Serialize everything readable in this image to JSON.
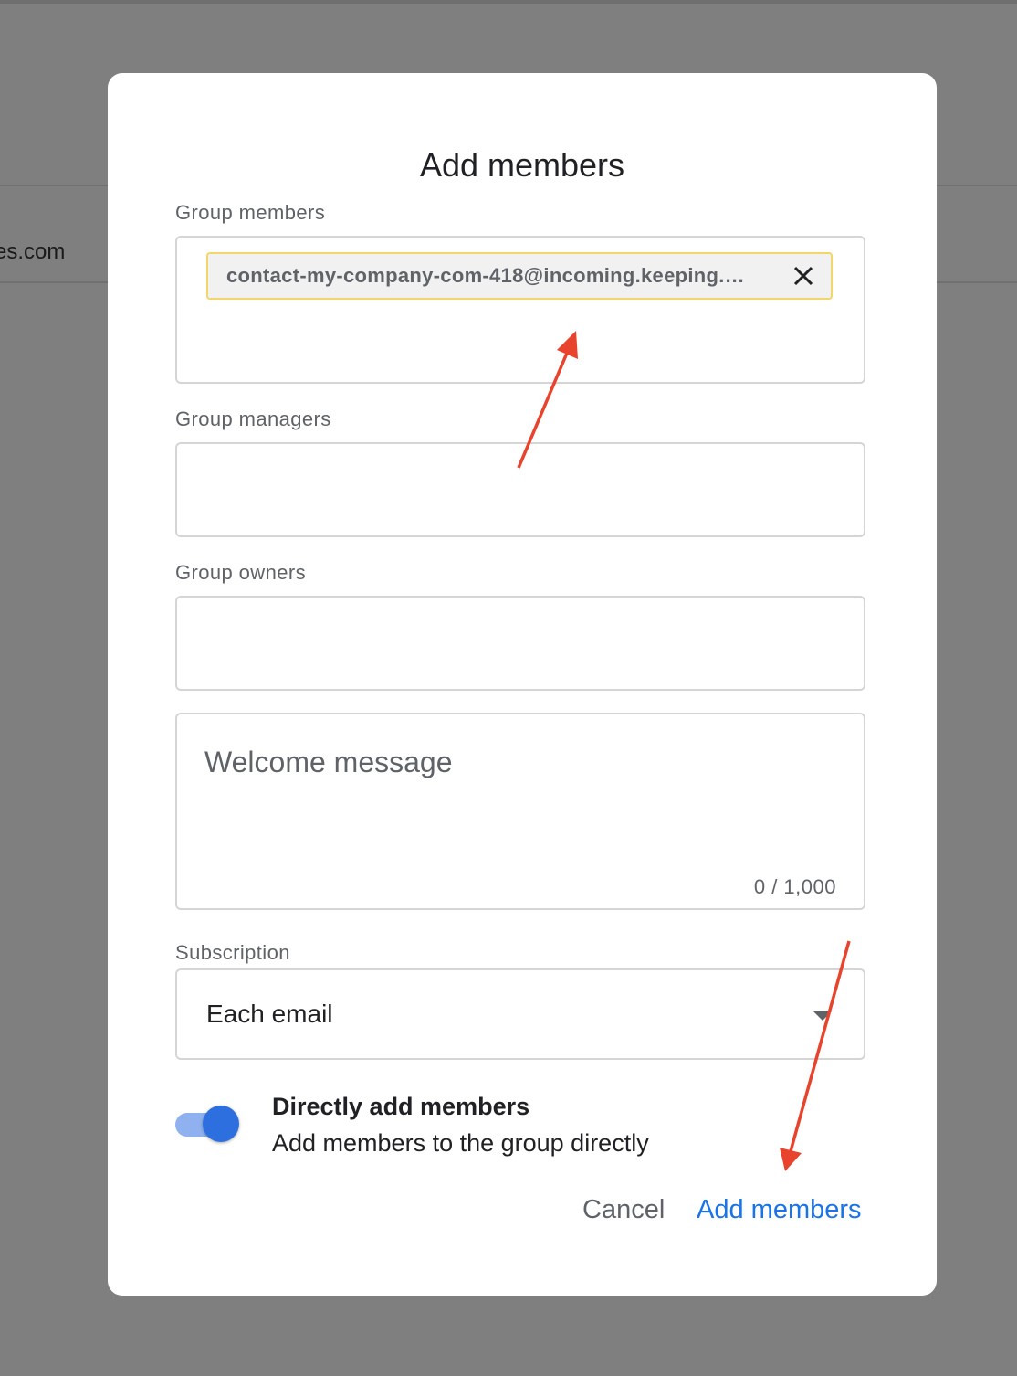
{
  "background": {
    "partial_domain": "es.com"
  },
  "dialog": {
    "title": "Add members",
    "group_members": {
      "label": "Group members",
      "chip_email": "contact-my-company-com-418@incoming.keeping.…"
    },
    "group_managers": {
      "label": "Group managers"
    },
    "group_owners": {
      "label": "Group owners"
    },
    "welcome_message": {
      "placeholder": "Welcome message",
      "counter": "0 / 1,000"
    },
    "subscription": {
      "label": "Subscription",
      "selected": "Each email"
    },
    "direct_add": {
      "title": "Directly add members",
      "description": "Add members to the group directly",
      "enabled": true
    },
    "actions": {
      "cancel": "Cancel",
      "add": "Add members"
    }
  },
  "colors": {
    "accent": "#1a73e8",
    "toggle_track": "#8fb1f0",
    "toggle_thumb": "#2e6fe0",
    "annotation_arrow": "#e8432d",
    "chip_border": "#f2d66b"
  },
  "icons": {
    "chip_remove": "close-icon",
    "dropdown": "chevron-down-icon"
  }
}
